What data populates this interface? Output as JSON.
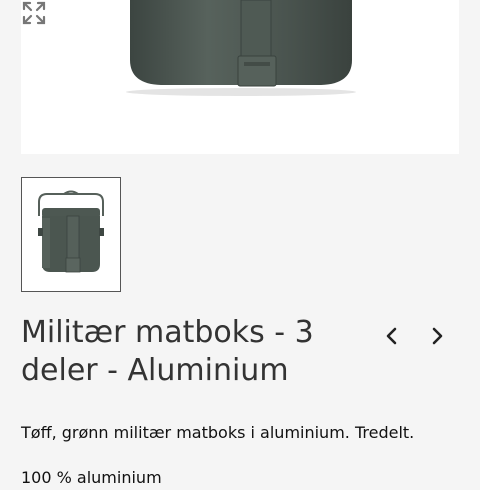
{
  "product": {
    "title": "Militær matboks - 3 deler - Aluminium",
    "description": "Tøff, grønn militær matboks i aluminium. Tredelt.",
    "spec_line": "100 % aluminium"
  },
  "gallery": {
    "main_image": "green-military-mess-kit-photo",
    "thumbnail": "green-military-mess-kit-thumbnail",
    "zoom_icon": "expand-icon",
    "prev_icon": "chevron-left-icon",
    "next_icon": "chevron-right-icon"
  },
  "colors": {
    "kit_green": "#4b5650",
    "page_bg": "#f5f5f5"
  }
}
